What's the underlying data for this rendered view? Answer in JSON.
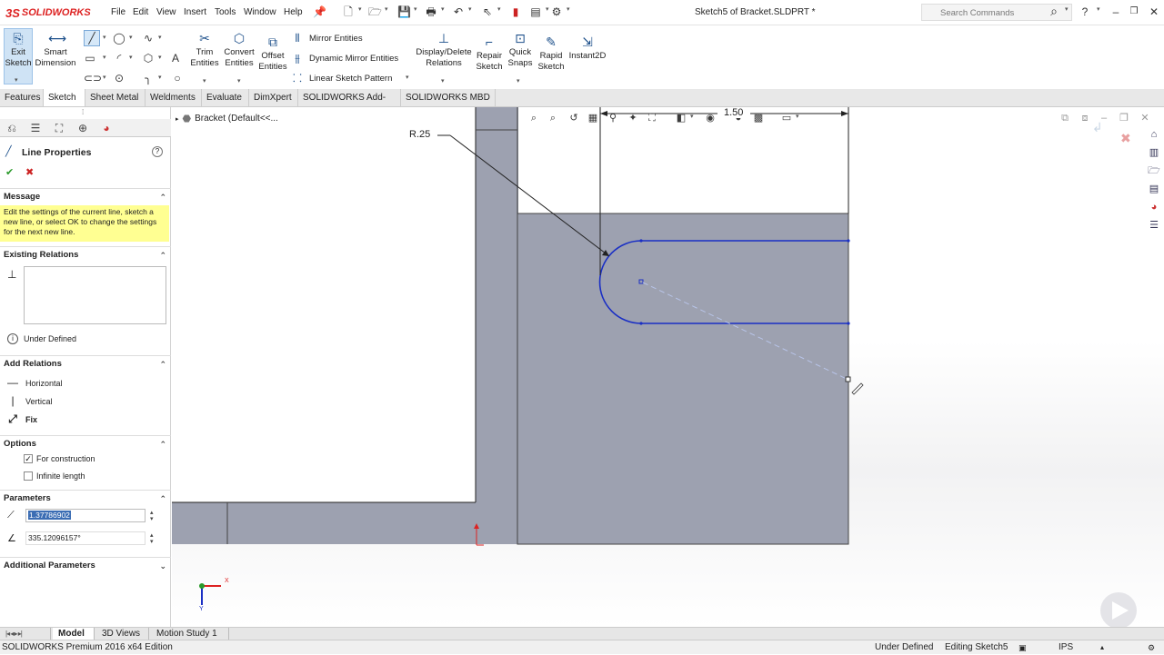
{
  "app": {
    "brand": "SOLIDWORKS",
    "doc_title": "Sketch5 of Bracket.SLDPRT *"
  },
  "menu": [
    "File",
    "Edit",
    "View",
    "Insert",
    "Tools",
    "Window",
    "Help"
  ],
  "search": {
    "placeholder": "Search Commands"
  },
  "commands": {
    "exit_sketch": "Exit Sketch",
    "smart_dimension": "Smart Dimension",
    "trim_entities": "Trim Entities",
    "convert_entities": "Convert Entities",
    "offset_entities": "Offset Entities",
    "mirror_entities": "Mirror Entities",
    "dynamic_mirror": "Dynamic Mirror Entities",
    "linear_pattern": "Linear Sketch Pattern",
    "display_delete_relations": "Display/Delete Relations",
    "repair_sketch": "Repair Sketch",
    "quick_snaps": "Quick Snaps",
    "rapid_sketch": "Rapid Sketch",
    "instant2d": "Instant2D"
  },
  "tabs": [
    "Features",
    "Sketch",
    "Sheet Metal",
    "Weldments",
    "Evaluate",
    "DimXpert",
    "SOLIDWORKS Add-Ins",
    "SOLIDWORKS MBD"
  ],
  "active_tab": "Sketch",
  "property_manager": {
    "title": "Line Properties",
    "message_header": "Message",
    "message": "Edit the settings of the current line, sketch a new line, or select OK to change the settings for the next new line.",
    "existing_relations_header": "Existing Relations",
    "status": "Under Defined",
    "add_relations_header": "Add Relations",
    "relations": [
      "Horizontal",
      "Vertical",
      "Fix"
    ],
    "options_header": "Options",
    "options": [
      {
        "label": "For construction",
        "checked": true
      },
      {
        "label": "Infinite length",
        "checked": false
      }
    ],
    "parameters_header": "Parameters",
    "length": "1.37786902",
    "angle": "335.12096157°",
    "additional_header": "Additional Parameters"
  },
  "feature_tree": {
    "label": "Bracket  (Default<<..."
  },
  "sketch": {
    "radius_label": "R.25",
    "dim_label": "1.50"
  },
  "bottom_tabs": [
    "Model",
    "3D Views",
    "Motion Study 1"
  ],
  "status_bar": {
    "edition": "SOLIDWORKS Premium 2016 x64 Edition",
    "state": "Under Defined",
    "editing": "Editing Sketch5",
    "units": "IPS"
  },
  "colors": {
    "sketch_blue": "#1a2fc4",
    "part_gray": "#9da1b0",
    "message_yellow": "#ffff92",
    "accent_red": "#d22222"
  }
}
